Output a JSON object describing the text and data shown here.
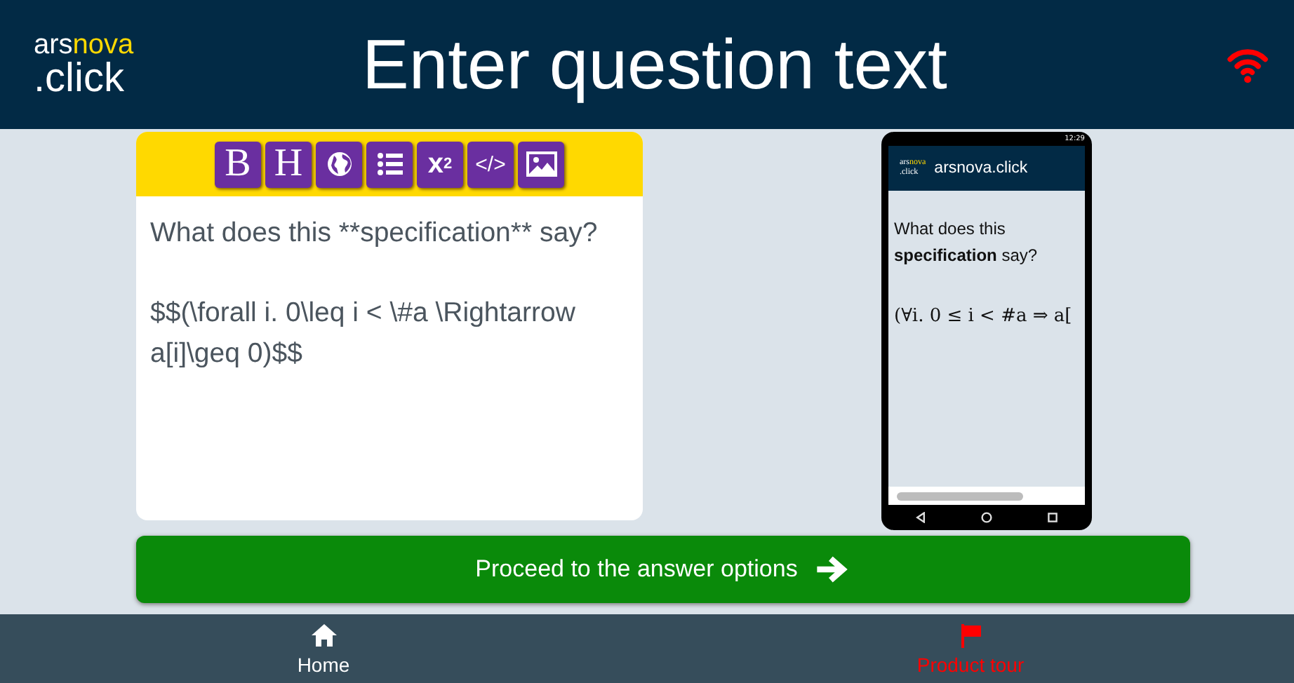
{
  "header": {
    "logo_top_a": "ars",
    "logo_top_b": "nova",
    "logo_bottom": ".click",
    "title": "Enter question text"
  },
  "toolbar": [
    {
      "kind": "text",
      "label": "B"
    },
    {
      "kind": "text",
      "label": "H"
    },
    {
      "kind": "globe"
    },
    {
      "kind": "list"
    },
    {
      "kind": "sup",
      "label": "x",
      "sup": "2"
    },
    {
      "kind": "code",
      "label": "</>"
    },
    {
      "kind": "image"
    }
  ],
  "editor": {
    "paragraphs": [
      "What does this **specification** say?",
      "$$(\\forall i. 0\\leq i < \\#a \\Rightarrow a[i]\\geq 0)$$"
    ]
  },
  "phone": {
    "time": "12:29",
    "logo_top_a": "ars",
    "logo_top_b": "nova",
    "logo_bottom": ".click",
    "app_title": "arsnova.click",
    "question": "What does this **specification** say?",
    "formula": "(∀i. 0 ≤ i < #a ⇒ a["
  },
  "proceed_button": {
    "label": "Proceed to the answer options"
  },
  "nav": [
    {
      "kind": "home",
      "label": "Home",
      "color": "#ffffff"
    },
    {
      "kind": "flag",
      "label": "Product tour",
      "color": "#ff0000"
    }
  ]
}
